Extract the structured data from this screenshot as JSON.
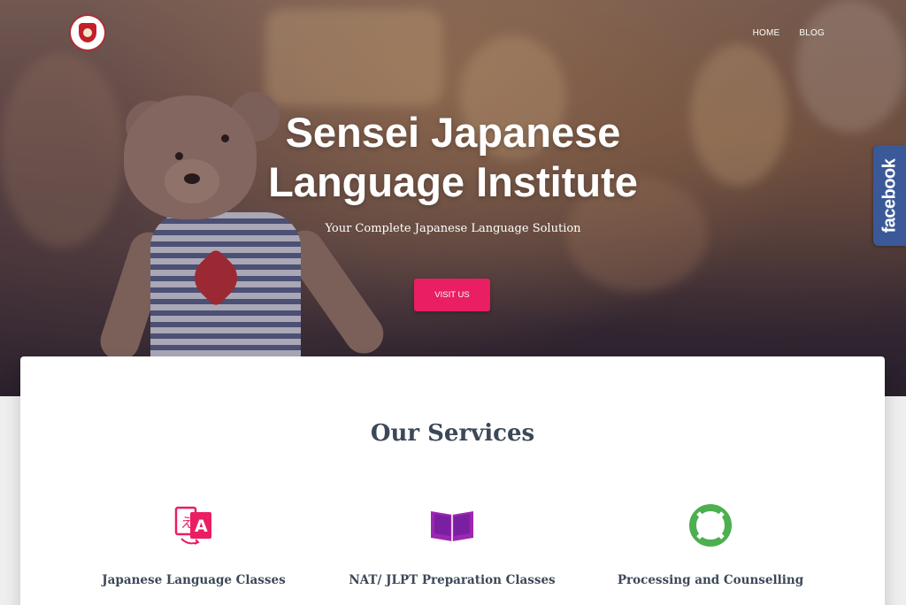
{
  "nav": {
    "items": [
      {
        "label": "HOME"
      },
      {
        "label": "BLOG"
      }
    ]
  },
  "hero": {
    "title_line1": "Sensei Japanese",
    "title_line2": "Language Institute",
    "subtitle": "Your Complete Japanese Language Solution",
    "cta_label": "VISIT US"
  },
  "social": {
    "facebook_label": "facebook"
  },
  "services": {
    "title": "Our Services",
    "items": [
      {
        "label": "Japanese Language Classes",
        "icon": "translate-icon",
        "color": "#e91e63"
      },
      {
        "label": "NAT/ JLPT Preparation Classes",
        "icon": "book-icon",
        "color": "#9c27b0"
      },
      {
        "label": "Processing and Counselling",
        "icon": "lifebuoy-icon",
        "color": "#4caf50"
      }
    ]
  },
  "colors": {
    "accent": "#e91e63",
    "facebook": "#3b5998",
    "heading": "#3c4858"
  }
}
